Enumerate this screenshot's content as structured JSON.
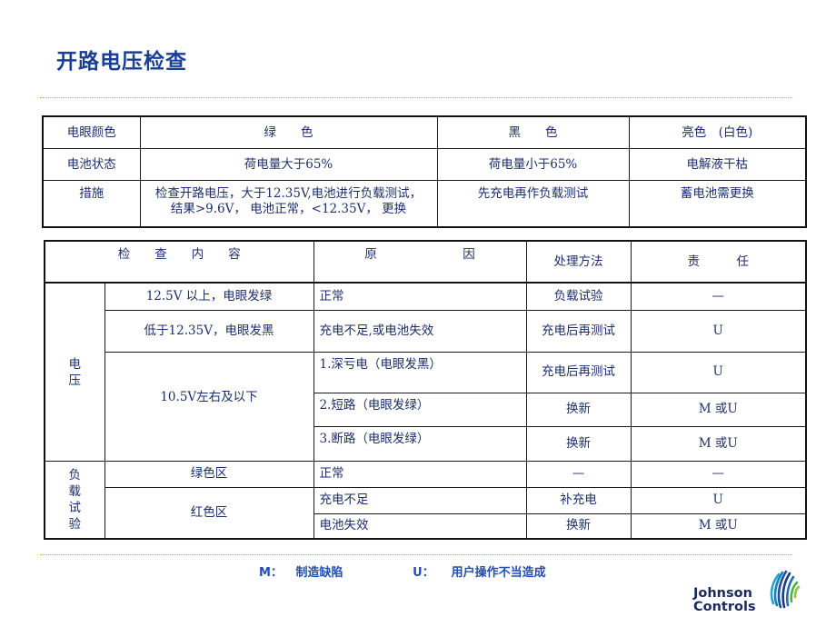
{
  "title": "开路电压检查",
  "table1": {
    "rows": [
      {
        "label": "电眼颜色",
        "c1": "绿　　色",
        "c2": "黑　　色",
        "c3": "亮色　(白色)"
      },
      {
        "label": "电池状态",
        "c1": "荷电量大于65%",
        "c2": "荷电量小于65%",
        "c3": "电解液干枯"
      },
      {
        "label": "措施",
        "c1": "检查开路电压，大于12.35V,电池进行负载测试，结果>9.6V， 电池正常，<12.35V， 更换",
        "c2": "先充电再作负载测试",
        "c3": "蓄电池需更换"
      }
    ]
  },
  "table2": {
    "headers": {
      "content": "检　　查　　内　　容",
      "reason": "原　　　　　　　因",
      "method": "处理方法",
      "responsibility": "责　　　任"
    },
    "groups": [
      {
        "category": "电压",
        "rows": [
          {
            "condition": "12.5V 以上，电眼发绿",
            "reason": "正常",
            "method": "负载试验",
            "responsibility": "—"
          },
          {
            "condition": "低于12.35V，电眼发黑",
            "reason": "充电不足,或电池失效",
            "method": "充电后再测试",
            "responsibility": "U"
          },
          {
            "condition": "10.5V左右及以下",
            "reason": "1.深亏电（电眼发黑）",
            "method": "充电后再测试",
            "responsibility": "U"
          },
          {
            "condition": "",
            "reason": "2.短路（电眼发绿）",
            "method": "换新",
            "responsibility": "M 或U"
          },
          {
            "condition": "",
            "reason": "3.断路（电眼发绿）",
            "method": "换新",
            "responsibility": "M 或U"
          }
        ]
      },
      {
        "category": "负载试验",
        "rows": [
          {
            "condition": "绿色区",
            "reason": "正常",
            "method": "—",
            "responsibility": "—"
          },
          {
            "condition": "红色区",
            "reason": "充电不足",
            "method": "补充电",
            "responsibility": "U"
          },
          {
            "condition": "",
            "reason": "电池失效",
            "method": "换新",
            "responsibility": "M 或U"
          }
        ]
      }
    ]
  },
  "legend": {
    "m_key": "M：",
    "m_text": "制造缺陷",
    "u_key": "U：",
    "u_text": "用户操作不当造成"
  },
  "logo": {
    "line1": "Johnson",
    "line2": "Controls"
  },
  "colors": {
    "title": "#1a3f95",
    "rule": "#8cc63f",
    "cell_text": "#1e2f6b",
    "legend": "#1f4fb5"
  }
}
